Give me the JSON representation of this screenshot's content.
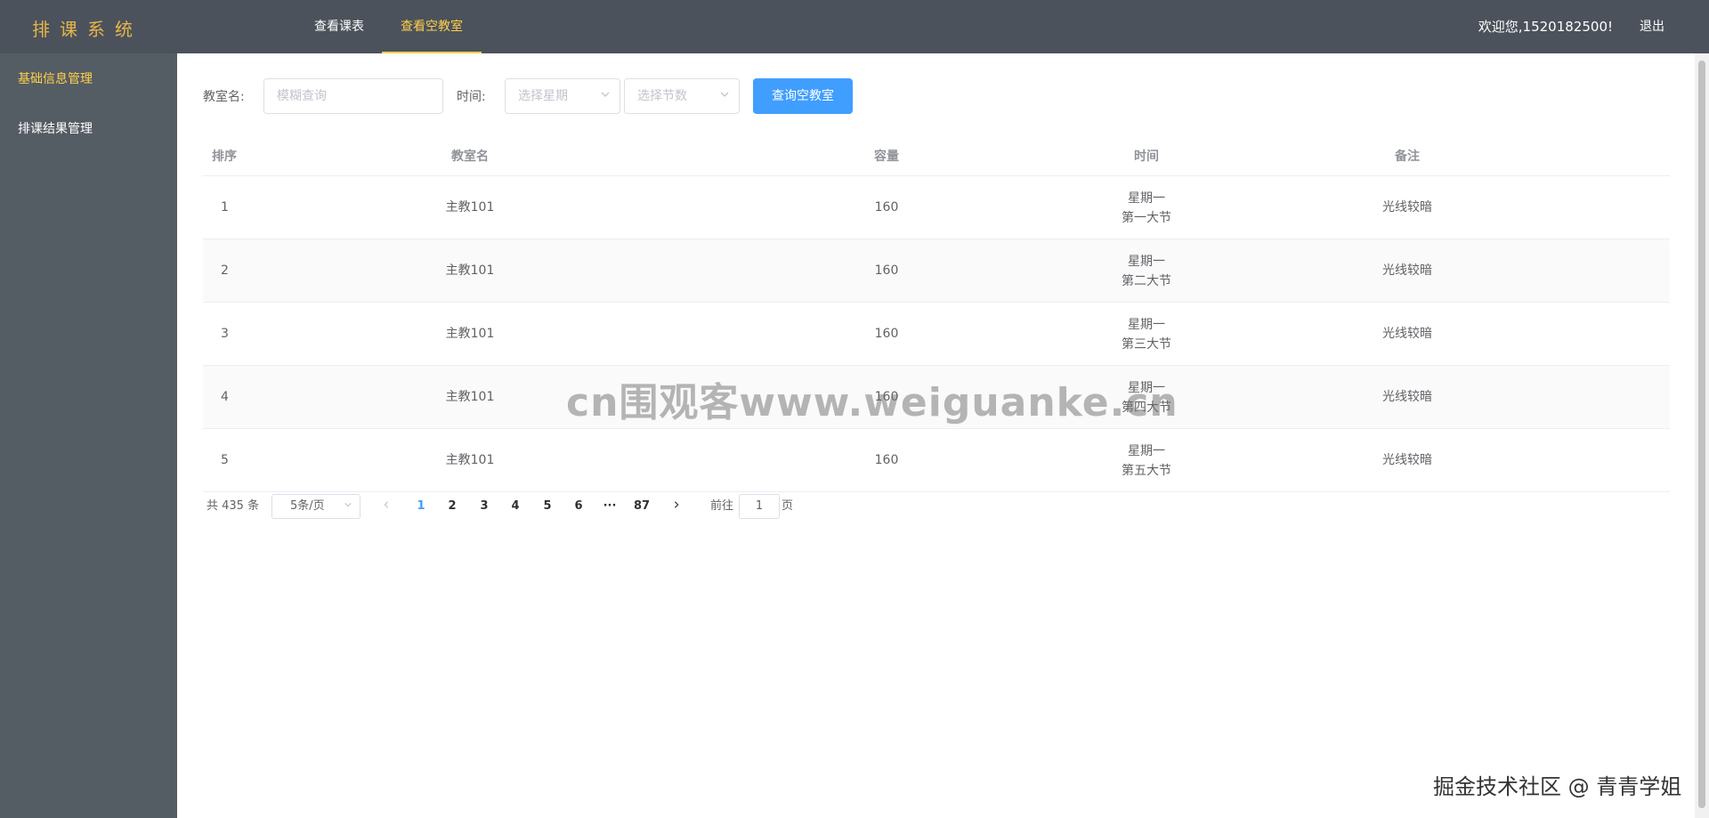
{
  "header": {
    "logo": "排课系统",
    "nav": [
      {
        "label": "查看课表",
        "active": false
      },
      {
        "label": "查看空教室",
        "active": true
      }
    ],
    "welcome": "欢迎您,1520182500!",
    "logout": "退出",
    "colors": {
      "background": "#4b525b",
      "accent": "#ffd04b"
    }
  },
  "sidebar": {
    "items": [
      {
        "label": "基础信息管理",
        "active": true
      },
      {
        "label": "排课结果管理",
        "active": false
      }
    ]
  },
  "filters": {
    "room_label": "教室名:",
    "room_placeholder": "模糊查询",
    "time_label": "时间:",
    "weekday_placeholder": "选择星期",
    "period_placeholder": "选择节数",
    "search_button": "查询空教室"
  },
  "table": {
    "headers": [
      "排序",
      "教室名",
      "容量",
      "时间",
      "备注"
    ],
    "rows": [
      {
        "index": "1",
        "room": "主教101",
        "capacity": "160",
        "day": "星期一",
        "period": "第一大节",
        "note": "光线较暗"
      },
      {
        "index": "2",
        "room": "主教101",
        "capacity": "160",
        "day": "星期一",
        "period": "第二大节",
        "note": "光线较暗"
      },
      {
        "index": "3",
        "room": "主教101",
        "capacity": "160",
        "day": "星期一",
        "period": "第三大节",
        "note": "光线较暗"
      },
      {
        "index": "4",
        "room": "主教101",
        "capacity": "160",
        "day": "星期一",
        "period": "第四大节",
        "note": "光线较暗"
      },
      {
        "index": "5",
        "room": "主教101",
        "capacity": "160",
        "day": "星期一",
        "period": "第五大节",
        "note": "光线较暗"
      }
    ]
  },
  "pagination": {
    "total": "共 435 条",
    "page_size": "5条/页",
    "prev_icon": "chevron-left-icon",
    "next_icon": "chevron-right-icon",
    "pages": [
      "1",
      "2",
      "3",
      "4",
      "5",
      "6",
      "···",
      "87"
    ],
    "current": "1",
    "goto_label": "前往",
    "goto_value": "1",
    "page_suffix": "页"
  },
  "watermarks": {
    "center": "cn围观客www.weiguanke.cn",
    "corner": "掘金技术社区 @ 青青学姐"
  }
}
